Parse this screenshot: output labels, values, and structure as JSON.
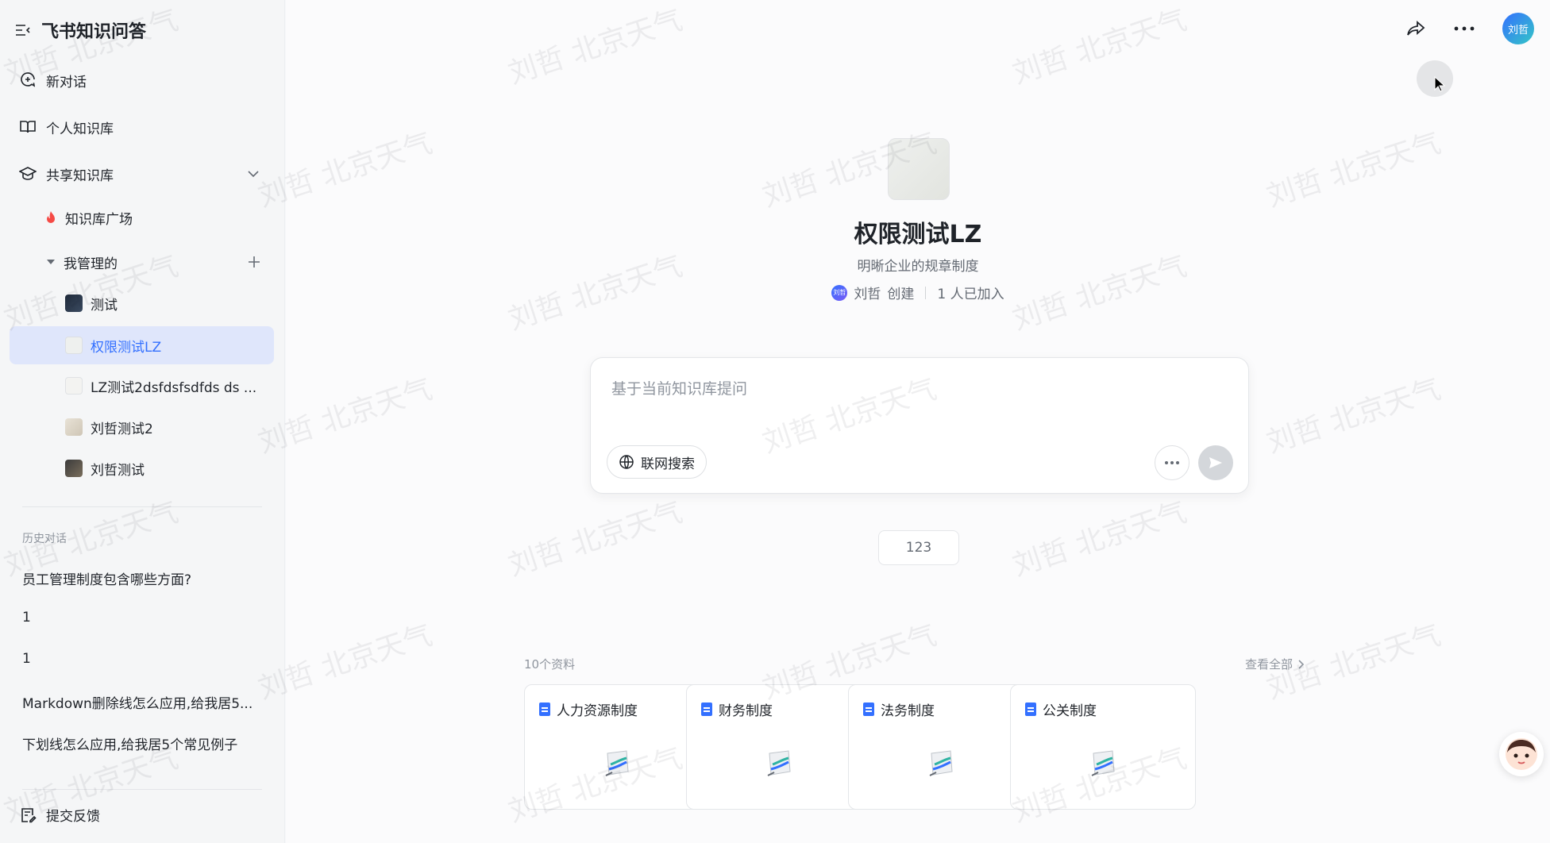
{
  "app": {
    "title": "飞书知识问答"
  },
  "sidebar": {
    "new_chat": "新对话",
    "personal_kb": "个人知识库",
    "shared_kb": "共享知识库",
    "kb_plaza": "知识库广场",
    "managed": "我管理的",
    "tree": [
      {
        "label": "测试"
      },
      {
        "label": "权限测试LZ"
      },
      {
        "label": "LZ测试2dsfdsfsdfds ds ..."
      },
      {
        "label": "刘哲测试2"
      },
      {
        "label": "刘哲测试"
      }
    ],
    "history_label": "历史对话",
    "history": [
      "员工管理制度包含哪些方面?",
      "1",
      "1",
      "Markdown删除线怎么应用,给我居5...",
      "下划线怎么应用,给我居5个常见例子"
    ],
    "feedback": "提交反馈"
  },
  "header": {
    "avatar_text": "刘哲"
  },
  "kb": {
    "title": "权限测试LZ",
    "desc": "明晰企业的规章制度",
    "creator": "刘哲",
    "creator_avatar": "刘哲",
    "created": "创建",
    "joined": "1 人已加入"
  },
  "ask": {
    "placeholder": "基于当前知识库提问",
    "web_search": "联网搜索"
  },
  "chip": "123",
  "resources": {
    "count": "10个资料",
    "view_all": "查看全部",
    "cards": [
      "人力资源制度",
      "财务制度",
      "法务制度",
      "公关制度"
    ]
  },
  "watermark": "刘哲 北京天气",
  "colors": {
    "accent": "#3370ff",
    "active_bg": "#dfe6fb",
    "kb_plaza_icon": "#f54a45"
  }
}
